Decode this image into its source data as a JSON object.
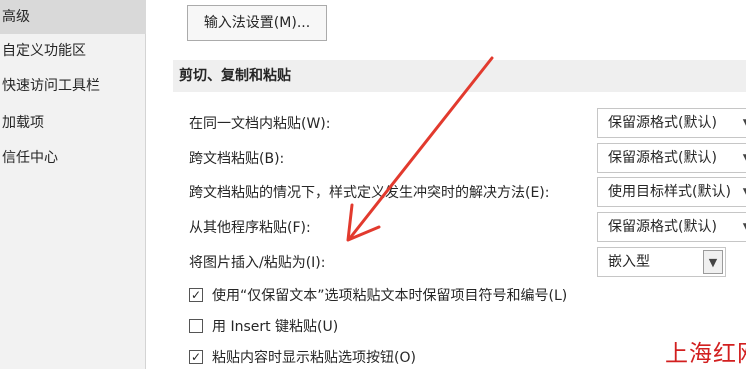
{
  "sidebar": {
    "items": [
      {
        "label": "高级",
        "selected": true
      },
      {
        "label": "自定义功能区",
        "selected": false
      },
      {
        "label": "快速访问工具栏",
        "selected": false
      },
      {
        "label": "加载项",
        "selected": false
      },
      {
        "label": "信任中心",
        "selected": false
      }
    ]
  },
  "top_button": {
    "label": "输入法设置(M)..."
  },
  "section": {
    "title": "剪切、复制和粘贴",
    "rows": [
      {
        "label": "在同一文档内粘贴(W):",
        "value": "保留源格式(默认)"
      },
      {
        "label": "跨文档粘贴(B):",
        "value": "保留源格式(默认)"
      },
      {
        "label": "跨文档粘贴的情况下，样式定义发生冲突时的解决方法(E):",
        "value": "使用目标样式(默认)"
      },
      {
        "label": "从其他程序粘贴(F):",
        "value": "保留源格式(默认)"
      },
      {
        "label": "将图片插入/粘贴为(I):",
        "value": "嵌入型"
      }
    ],
    "checkboxes": [
      {
        "label": "使用“仅保留文本”选项粘贴文本时保留项目符号和编号(L)",
        "checked": true
      },
      {
        "label": "用 Insert 键粘贴(U)",
        "checked": false
      },
      {
        "label": "粘贴内容时显示粘贴选项按钮(O)",
        "checked": true
      }
    ]
  },
  "annotation": {
    "color": "#e23a2e"
  },
  "watermark": {
    "text": "上海红网",
    "color": "#d21f1f"
  }
}
